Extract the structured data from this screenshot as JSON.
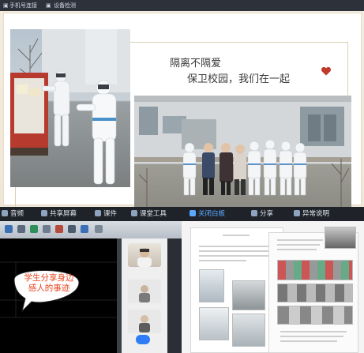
{
  "top_toolbar": {
    "left_label": "手机号连接",
    "right_label": "设备检测"
  },
  "slide": {
    "caption_line1": "隔离不隔爱",
    "caption_line2": "保卫校园，我们在一起",
    "heart_color": "#c0392b"
  },
  "meeting_toolbar": {
    "items": [
      {
        "label": "音频",
        "icon": "microphone-icon"
      },
      {
        "label": "共享屏幕",
        "icon": "screen-share-icon"
      },
      {
        "label": "课件",
        "icon": "courseware-icon"
      },
      {
        "label": "课堂工具",
        "icon": "classroom-tools-icon"
      },
      {
        "label": "关闭白板",
        "icon": "whiteboard-icon",
        "active": true
      },
      {
        "label": "分享",
        "icon": "share-icon"
      },
      {
        "label": "异常说明",
        "icon": "info-icon"
      }
    ]
  },
  "video_call": {
    "speech_bubble": "学生分享身边感人的事迹",
    "end_button_color": "#2e7cf6"
  }
}
